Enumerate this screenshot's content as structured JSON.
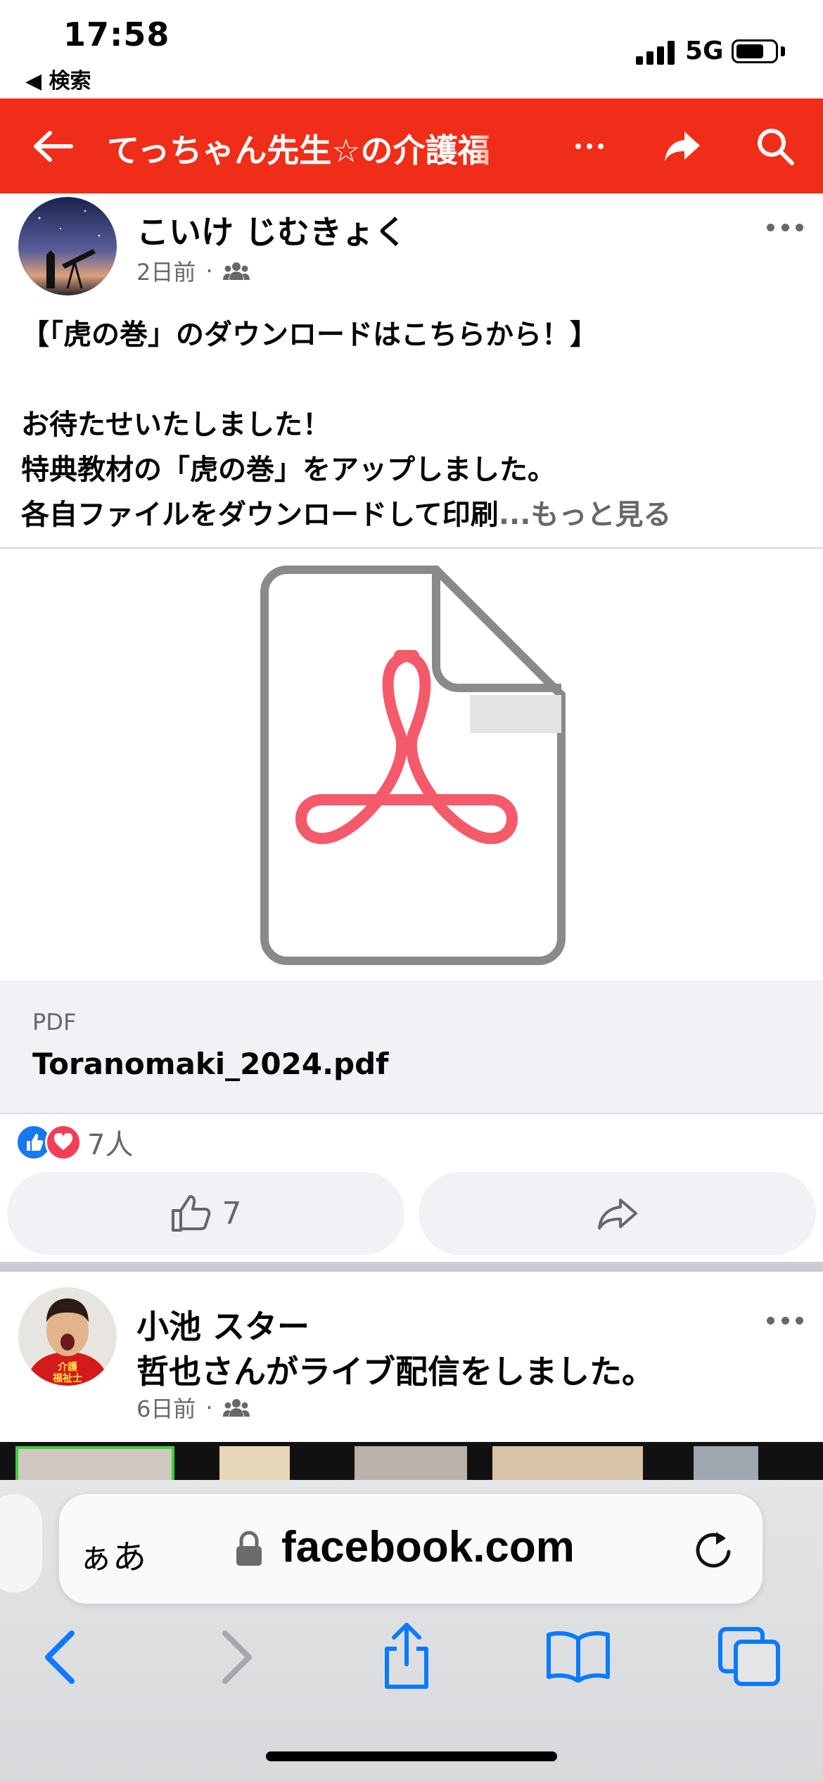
{
  "status_bar": {
    "time": "17:58",
    "back_label": "◀ 検索",
    "network": "5G"
  },
  "header": {
    "title": "てっちゃん先生☆の介護福",
    "accent_color": "#f02d18",
    "icons": [
      "back-arrow-icon",
      "more-icon",
      "share-icon",
      "search-icon"
    ]
  },
  "post1": {
    "author": "こいけ じむきょく",
    "time": "2日前",
    "audience_icon": "group-icon",
    "lines": [
      "【「虎の巻」のダウンロードはこちらから！】",
      "",
      "お待たせいたしました！",
      "特典教材の「虎の巻」をアップしました。",
      "各自ファイルをダウンロードして印刷"
    ],
    "ellipsis": "...",
    "see_more": "もっと見る",
    "attachment": {
      "type": "PDF",
      "file_name": "Toranomaki_2024.pdf",
      "icon": "pdf-file-icon"
    },
    "reaction_count": "7人",
    "like_count": "7"
  },
  "post2": {
    "author": "小池 スター",
    "subtitle": "哲也さんがライブ配信をしました。",
    "time": "6日前",
    "avatar_text": "介護\n福祉士"
  },
  "browser": {
    "aa_label": "ぁあ",
    "url": "facebook.com",
    "accent_color": "#0a7aff"
  }
}
